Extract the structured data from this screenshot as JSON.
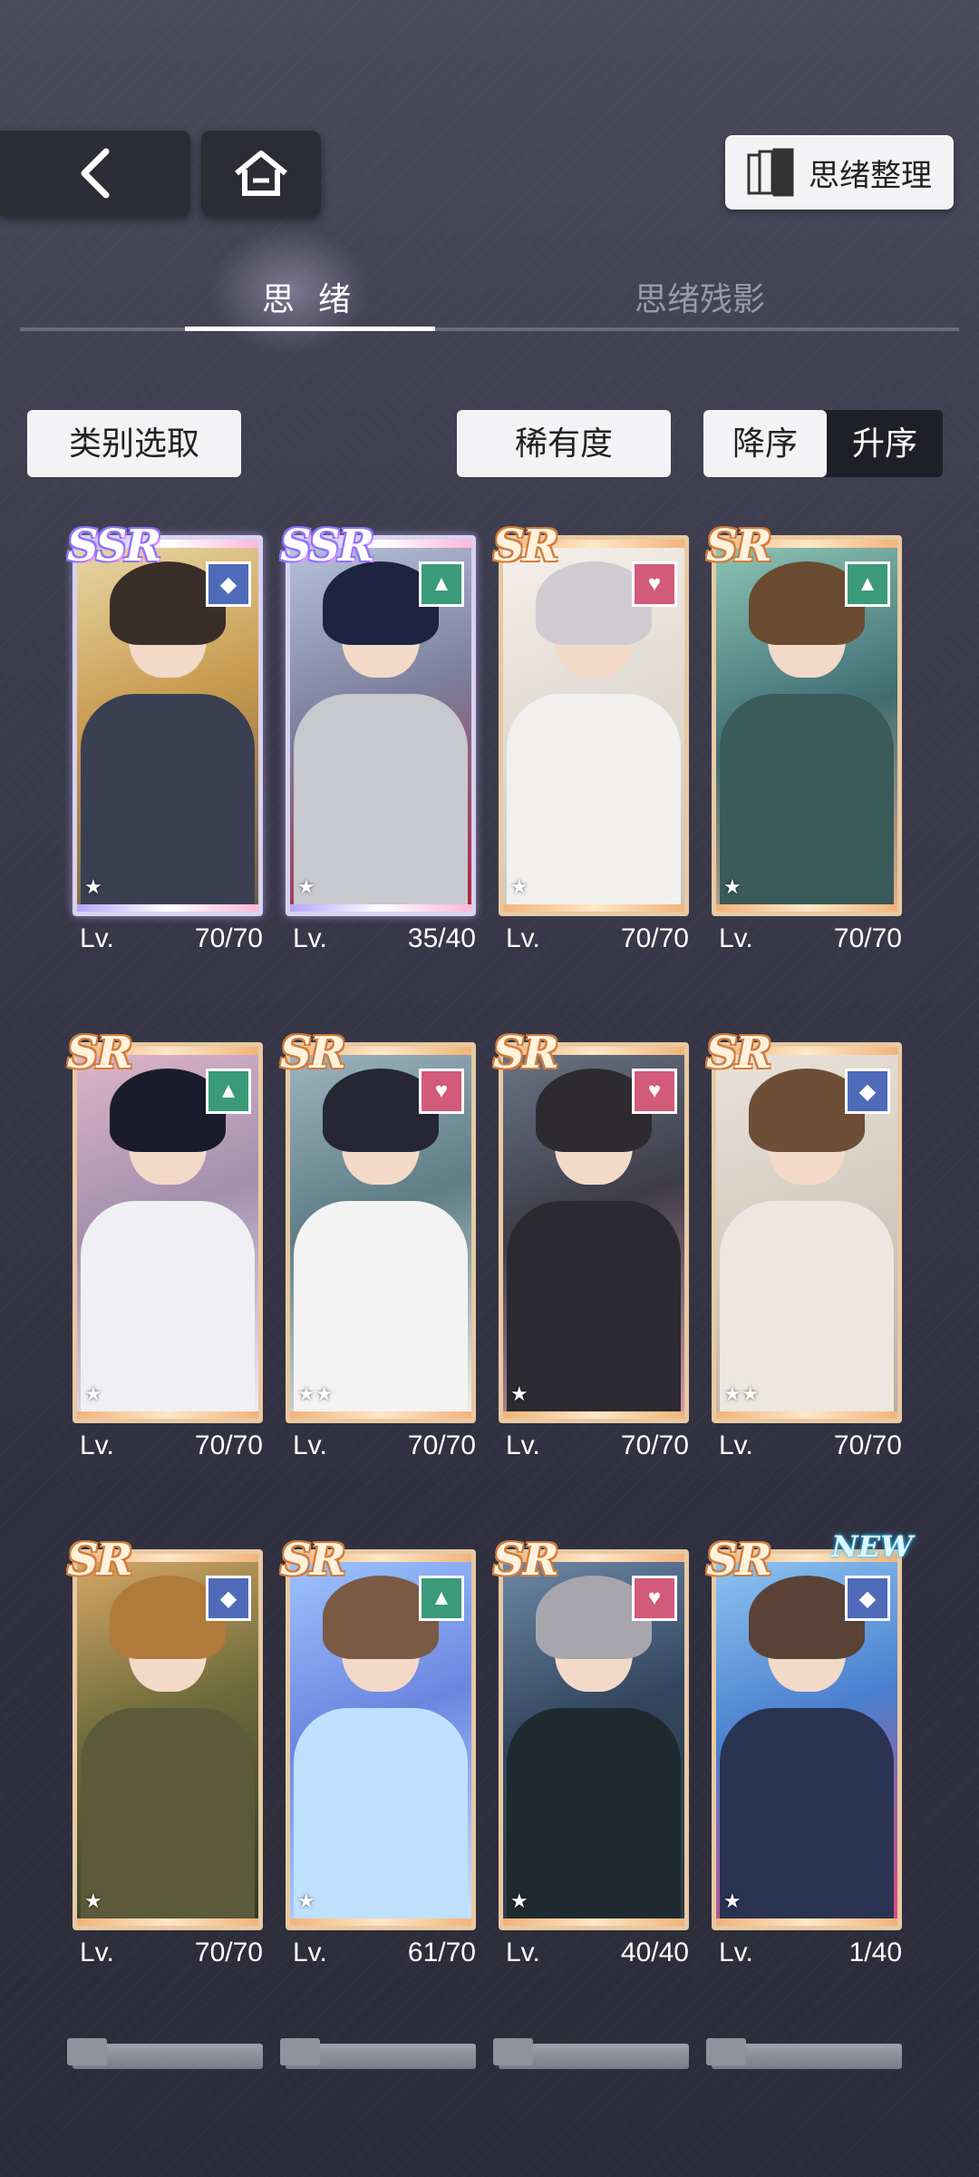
{
  "nav": {
    "back_icon": "back-chevron-icon",
    "home_icon": "home-icon"
  },
  "organize_button": {
    "label": "思绪整理",
    "icon": "cards-stack-icon"
  },
  "tabs": [
    {
      "label": "思 绪",
      "active": true
    },
    {
      "label": "思绪残影",
      "active": false
    }
  ],
  "filters": {
    "category_label": "类别选取",
    "rarity_label": "稀有度",
    "desc_label": "降序",
    "asc_label": "升序",
    "active_sort": "asc"
  },
  "level_prefix": "Lv.",
  "cards": [
    {
      "rarity": "SSR",
      "attribute": "blue-diamond-icon",
      "stars": "★",
      "level": "70/70",
      "is_new": false
    },
    {
      "rarity": "SSR",
      "attribute": "green-triangle-icon",
      "stars": "★",
      "level": "35/40",
      "is_new": false
    },
    {
      "rarity": "SR",
      "attribute": "pink-heart-icon",
      "stars": "★",
      "level": "70/70",
      "is_new": false
    },
    {
      "rarity": "SR",
      "attribute": "green-triangle-icon",
      "stars": "★",
      "level": "70/70",
      "is_new": false
    },
    {
      "rarity": "SR",
      "attribute": "green-triangle-icon",
      "stars": "★",
      "level": "70/70",
      "is_new": false
    },
    {
      "rarity": "SR",
      "attribute": "pink-heart-icon",
      "stars": "★★",
      "level": "70/70",
      "is_new": false
    },
    {
      "rarity": "SR",
      "attribute": "pink-heart-icon",
      "stars": "★",
      "level": "70/70",
      "is_new": false
    },
    {
      "rarity": "SR",
      "attribute": "blue-diamond-icon",
      "stars": "★★",
      "level": "70/70",
      "is_new": false
    },
    {
      "rarity": "SR",
      "attribute": "blue-diamond-icon",
      "stars": "★",
      "level": "70/70",
      "is_new": false
    },
    {
      "rarity": "SR",
      "attribute": "green-triangle-icon",
      "stars": "★",
      "level": "61/70",
      "is_new": false
    },
    {
      "rarity": "SR",
      "attribute": "pink-heart-icon",
      "stars": "★",
      "level": "40/40",
      "is_new": false
    },
    {
      "rarity": "SR",
      "attribute": "blue-diamond-icon",
      "stars": "★",
      "level": "1/40",
      "is_new": true,
      "new_label": "NEW"
    }
  ],
  "colors": {
    "blue_attr": "#4f6ab8",
    "green_attr": "#3a9a79",
    "pink_attr": "#d25a7a"
  }
}
